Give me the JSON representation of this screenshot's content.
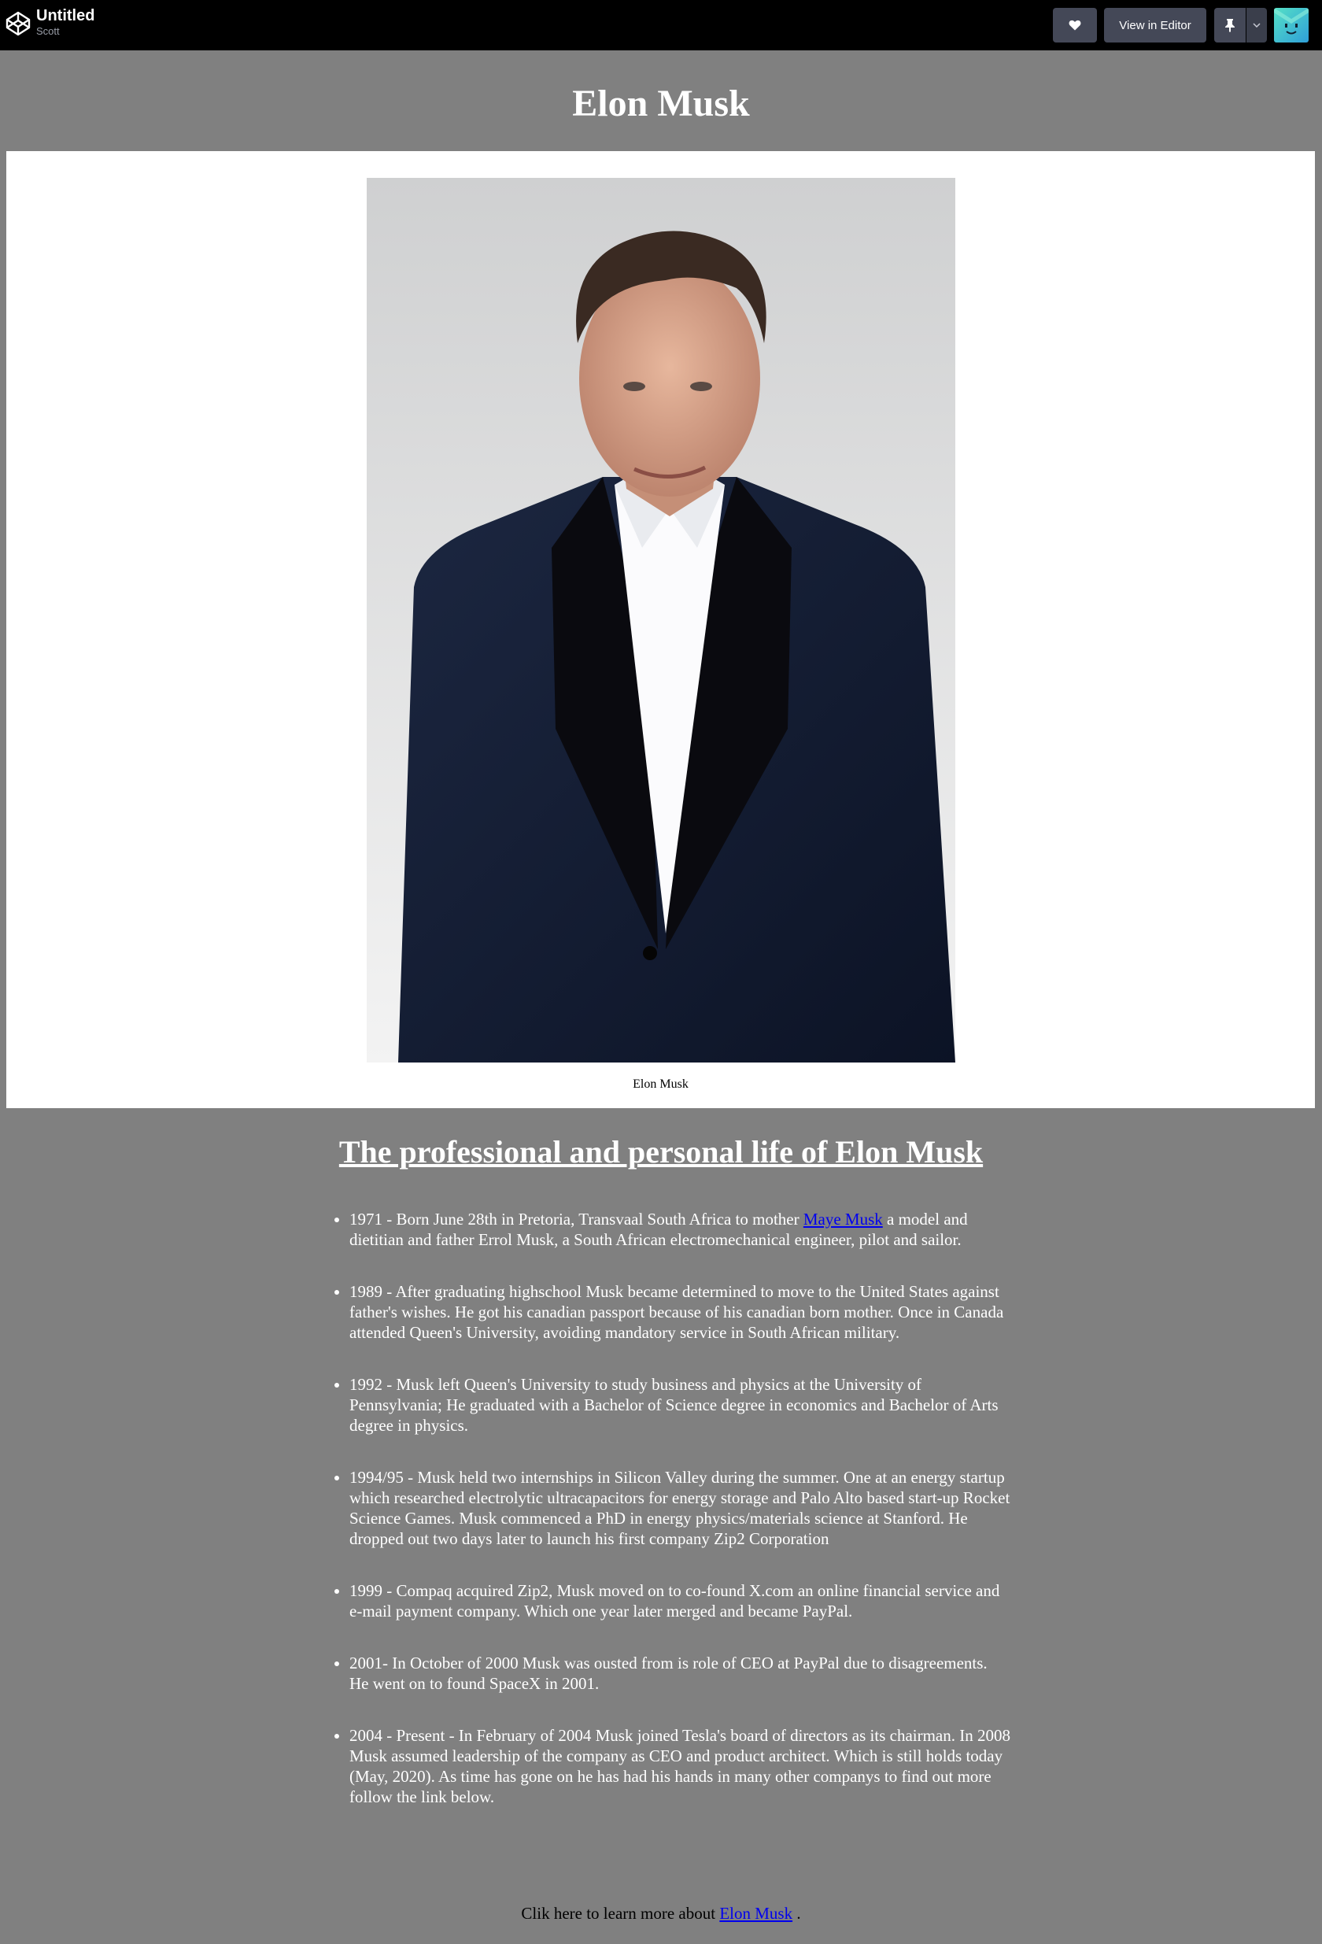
{
  "topbar": {
    "title": "Untitled",
    "user": "Scott",
    "heart_icon": "heart-icon",
    "view_in_editor_label": "View in Editor",
    "pin_icon": "pin-icon",
    "caret_icon": "chevron-down-icon",
    "avatar_colors": [
      "#4ad0c0",
      "#3ba7e0"
    ]
  },
  "main": {
    "title": "Elon Musk",
    "figure": {
      "caption": "Elon Musk"
    },
    "section_heading": "The professional and personal life of Elon Musk",
    "timeline": [
      {
        "before": "1971 - Born June 28th in Pretoria, Transvaal South Africa to mother ",
        "link": "Maye Musk",
        "after": " a model and dietitian and father Errol Musk, a South African electromechanical engineer, pilot and sailor."
      },
      {
        "text": "1989 - After graduating highschool Musk became determined to move to the United States against father's wishes. He got his canadian passport because of his canadian born mother. Once in Canada attended Queen's University, avoiding mandatory service in South African military."
      },
      {
        "text": "1992 - Musk left Queen's University to study business and physics at the University of Pennsylvania; He graduated with a Bachelor of Science degree in economics and Bachelor of Arts degree in physics."
      },
      {
        "text": "1994/95 - Musk held two internships in Silicon Valley during the summer. One at an energy startup which researched electrolytic ultracapacitors for energy storage and Palo Alto based start-up Rocket Science Games. Musk commenced a PhD in energy physics/materials science at Stanford. He dropped out two days later to launch his first company Zip2 Corporation"
      },
      {
        "text": "1999 - Compaq acquired Zip2, Musk moved on to co-found X.com an online financial service and e-mail payment company. Which one year later merged and became PayPal."
      },
      {
        "text": "2001- In October of 2000 Musk was ousted from is role of CEO at PayPal due to disagreements. He went on to found SpaceX in 2001."
      },
      {
        "text": "2004 - Present - In February of 2004 Musk joined Tesla's board of directors as its chairman. In 2008 Musk assumed leadership of the company as CEO and product architect. Which is still holds today (May, 2020). As time has gone on he has had his hands in many other companys to find out more follow the link below."
      }
    ],
    "footer": {
      "before": "Clik here to learn more about ",
      "link": "Elon Musk",
      "after": " ."
    },
    "colors": {
      "page_background": "#808080",
      "figure_background": "#ffffff",
      "link": "#0000ee"
    }
  }
}
